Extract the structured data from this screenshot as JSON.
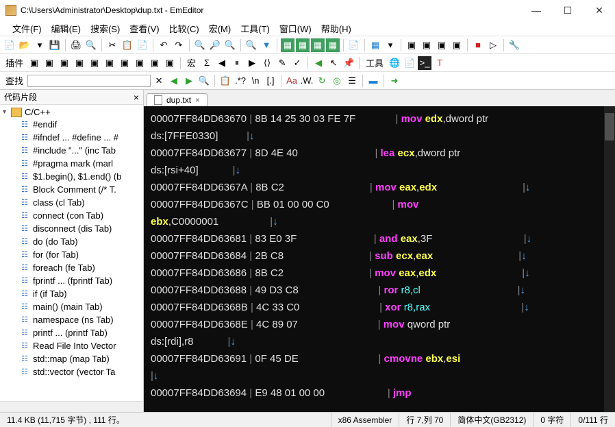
{
  "window": {
    "title": "C:\\Users\\Administrator\\Desktop\\dup.txt - EmEditor"
  },
  "menu": [
    "文件(F)",
    "编辑(E)",
    "搜索(S)",
    "查看(V)",
    "比较(C)",
    "宏(M)",
    "工具(T)",
    "窗口(W)",
    "帮助(H)"
  ],
  "toolbar_labels": {
    "plugins": "插件",
    "macro": "宏",
    "tools": "工具",
    "find": "查找"
  },
  "sidepanel": {
    "title": "代码片段",
    "root": "C/C++",
    "items": [
      "#endif",
      "#ifndef ... #define ... #",
      "#include \"...\"  (inc Tab",
      "#pragma mark  (marl",
      "$1.begin(), $1.end()  (b",
      "Block Comment  (/* T.",
      "class  (cl Tab)",
      "connect  (con Tab)",
      "disconnect  (dis Tab)",
      "do  (do Tab)",
      "for  (for Tab)",
      "foreach  (fe Tab)",
      "fprintf ...  (fprintf Tab)",
      "if  (if Tab)",
      "main()  (main Tab)",
      "namespace  (ns Tab)",
      "printf ...  (printf Tab)",
      "Read File Into Vector",
      "std::map  (map Tab)",
      "std::vector  (vector Ta"
    ]
  },
  "tab": {
    "name": "dup.txt"
  },
  "code_lines": [
    {
      "a": "00007FF84DD63670",
      "b": "8B 14 25 30 03 FE 7F",
      "sp": 14,
      "m": "mov",
      "r1": "edx",
      "txt": ",dword ptr"
    },
    {
      "cont": "ds:[7FFE0330]",
      "arrow": true,
      "asp": 10
    },
    {
      "a": "00007FF84DD63677",
      "b": "8D 4E 40",
      "sp": 27,
      "m": "lea",
      "r1": "ecx",
      "txt": ",dword ptr"
    },
    {
      "cont": "ds:[rsi+40]",
      "arrow": true,
      "asp": 12
    },
    {
      "a": "00007FF84DD6367A",
      "b": "8B C2",
      "sp": 30,
      "m": "mov",
      "r1": "eax",
      "r2": "edx",
      "arrow": true,
      "esp": 30
    },
    {
      "a": "00007FF84DD6367C",
      "b": "BB 01 00 00 C0",
      "sp": 22,
      "m": "mov"
    },
    {
      "cont_reg": "ebx",
      "cont_txt": ",C0000001",
      "arrow": true,
      "asp": 18
    },
    {
      "a": "00007FF84DD63681",
      "b": "83 E0 3F",
      "sp": 27,
      "m": "and",
      "r1": "eax",
      "txt": ",3F",
      "arrow": true,
      "esp": 32
    },
    {
      "a": "00007FF84DD63684",
      "b": "2B C8",
      "sp": 30,
      "m": "sub",
      "r1": "ecx",
      "r2": "eax",
      "arrow": true,
      "esp": 30
    },
    {
      "a": "00007FF84DD63686",
      "b": "8B C2",
      "sp": 30,
      "m": "mov",
      "r1": "eax",
      "r2": "edx",
      "arrow": true,
      "esp": 30
    },
    {
      "a": "00007FF84DD63688",
      "b": "49 D3 C8",
      "sp": 28,
      "m": "ror",
      "rc": "r8,cl",
      "arrow": true,
      "esp": 34
    },
    {
      "a": "00007FF84DD6368B",
      "b": "4C 33 C0",
      "sp": 28,
      "m": "xor",
      "rc": "r8,rax",
      "arrow": true,
      "esp": 32
    },
    {
      "a": "00007FF84DD6368E",
      "b": "4C 89 07",
      "sp": 28,
      "m": "mov",
      "txt": " qword ptr"
    },
    {
      "cont": "ds:[rdi],r8",
      "arrow": true,
      "asp": 12
    },
    {
      "a": "00007FF84DD63691",
      "b": "0F 45 DE",
      "sp": 28,
      "m": "cmovne",
      "r1": "ebx",
      "r2": "esi"
    },
    {
      "arrow": true,
      "asp": 0
    },
    {
      "a": "00007FF84DD63694",
      "b": "E9 48 01 00 00",
      "sp": 22,
      "m": "jmp"
    }
  ],
  "status": {
    "left": "11.4 KB (11,715 字节) , 111 行。",
    "mode": "x86 Assembler",
    "pos": "行 7,列 70",
    "enc": "简体中文(GB2312)",
    "sel": "0 字符",
    "lines": "0/111 行"
  }
}
